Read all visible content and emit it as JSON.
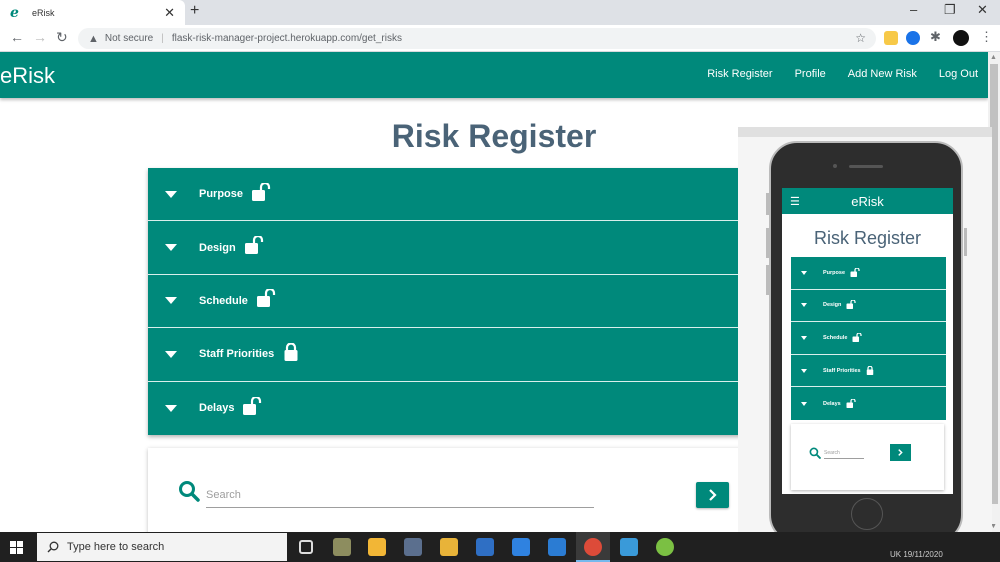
{
  "browser": {
    "tab_title": "eRisk",
    "tab_favicon": "e",
    "new_tab": "+",
    "not_secure": "Not secure",
    "url": "flask-risk-manager-project.herokuapp.com/get_risks"
  },
  "nav": {
    "brand": "eRisk",
    "links": [
      "Risk Register",
      "Profile",
      "Add New Risk",
      "Log Out"
    ]
  },
  "page": {
    "title": "Risk Register",
    "risks": [
      {
        "label": "Purpose",
        "locked": false
      },
      {
        "label": "Design",
        "locked": false
      },
      {
        "label": "Schedule",
        "locked": false
      },
      {
        "label": "Staff Priorities",
        "locked": true
      },
      {
        "label": "Delays",
        "locked": false
      }
    ],
    "search_placeholder": "Search"
  },
  "phone": {
    "brand": "eRisk",
    "title": "Risk Register",
    "risks": [
      "Purpose",
      "Design",
      "Schedule",
      "Staff Priorities",
      "Delays"
    ],
    "search_placeholder": "Search"
  },
  "taskbar": {
    "search_placeholder": "Type here to search",
    "clock_fragment": "UK    19/11/2020"
  },
  "colors": {
    "accent": "#00897b",
    "title": "#4a6377"
  }
}
